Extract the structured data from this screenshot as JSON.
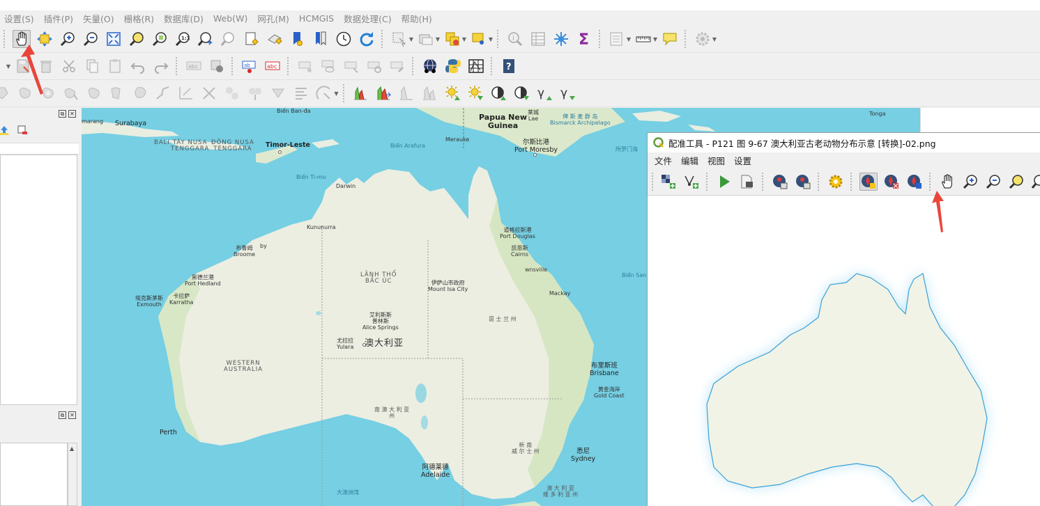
{
  "menu": [
    "设置(S)",
    "插件(P)",
    "矢量(O)",
    "栅格(R)",
    "数据库(D)",
    "Web(W)",
    "网孔(M)",
    "HCMGIS",
    "数据处理(C)",
    "帮助(H)"
  ],
  "map": {
    "country_label": "澳大利亚",
    "labels": {
      "bien_banda": "Biển Ban-đa",
      "marang": "marang",
      "surabaya": "Surabaya",
      "bali": "BALI",
      "tay_nusa": "TÂY NUSA\nTENGGARA",
      "dong_nusa": "ĐÔNG NUSA\nTENGGARA",
      "timor": "Timor-Leste",
      "bien_arafura": "Biển Arafura",
      "merauke": "Merauke",
      "papua": "Papua New\nGuinea",
      "lae": "莱城\nLae",
      "bismarck": "俾 斯 麦 群 岛\nBismarck Archipelago",
      "port_moresby": "尔斯比港\nPort Moresby",
      "suo_luo_men": "所罗门海",
      "tonga": "Tonga",
      "bien_timo": "Biển Ti-mo",
      "darwin": "Darwin",
      "kununurra": "Kununurra",
      "by": "by",
      "broome": "布鲁姆\nBroome",
      "port_douglas": "道格拉斯港\nPort Douglas",
      "cairns": "凯恩斯\nCairns",
      "townsville": "wnsville",
      "bien_san_ho": "Biển San H",
      "lanh_tho": "LÃNH THỔ\nBẮC ÚC",
      "mount_isa": "伊萨山市政府\nMount Isa City",
      "port_hedland": "黑德兰港\nPort Hedland",
      "exmouth": "埃克斯茅斯\nExmouth",
      "karratha": "卡拉萨\nKarratha",
      "mackay": "Mackay",
      "alice": "艾利斯斯\n普林斯\nAlice Springs",
      "queensland": "昆 士 兰 州",
      "yulara": "尤拉拉\nYulara",
      "western_australia": "WESTERN\nAUSTRALIA",
      "brisbane": "布里斯班\nBrisbane",
      "gold_coast": "黄金海岸\nGold Coast",
      "south_australia": "南 澳 大 利 亚\n州",
      "perth": "Perth",
      "nsw": "新 南\n威 尔 士 州",
      "sydney": "悉尼\nSydney",
      "adelaide": "阿德莱德\nAdelaide",
      "great_bight": "大澳洲湾",
      "victoria": "澳 大 利 亚\n维 多 利 亚 州"
    }
  },
  "georeferencer": {
    "title": "配准工具 - P121 图 9-67 澳大利亚古老动物分布示意 [转换]-02.png",
    "menu": [
      "文件",
      "编辑",
      "视图",
      "设置"
    ]
  },
  "icons": {
    "toolbar1": [
      "pan-hand-icon",
      "pan-to-selection-icon",
      "zoom-in-icon",
      "zoom-out-icon",
      "zoom-full-icon",
      "zoom-to-selection-icon",
      "zoom-to-layer-icon",
      "zoom-native-icon",
      "zoom-last-icon",
      "zoom-next-icon",
      "new-bookmark-icon",
      "show-bookmarks-icon",
      "temporal-controller-icon",
      "refresh-icon",
      "select-features-icon",
      "deselect-icon",
      "annotation-icon",
      "identify-icon",
      "attribute-table-icon",
      "field-calculator-icon",
      "sum-icon",
      "measure-icon",
      "map-tips-icon",
      "processing-icon"
    ],
    "accent_red": "#e8463a"
  }
}
